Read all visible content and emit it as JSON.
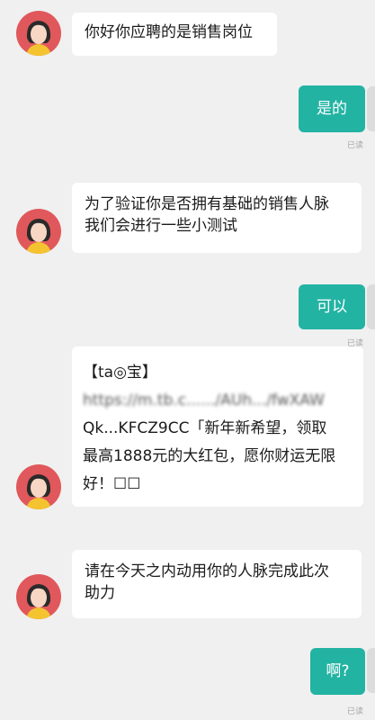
{
  "chat": {
    "messages": [
      {
        "side": "left",
        "text": "你好你应聘的是销售岗位"
      },
      {
        "side": "right",
        "text": "是的",
        "status": "已读"
      },
      {
        "side": "left",
        "lines": [
          "为了验证你是否拥有基础的销售人脉",
          "我们会进行一些小测试"
        ]
      },
      {
        "side": "right",
        "text": "可以",
        "status": "已读"
      },
      {
        "side": "left",
        "link_lines": [
          "【ta◎宝】",
          "https://m.tb.c....../AUh.../fwXAW",
          "Qk...KFCZ9CC「新年新希望，领取",
          "最高1888元的大红包，愿你财运无限",
          "好！☐☐"
        ]
      },
      {
        "side": "left",
        "lines": [
          "请在今天之内动用你的人脉完成此次",
          "助力"
        ]
      },
      {
        "side": "right",
        "text": "啊?",
        "status": "已读"
      }
    ]
  },
  "colors": {
    "background": "#f0f0f0",
    "bubble_left": "#ffffff",
    "bubble_right": "#23b3a3",
    "avatar_bg": "#e0585b"
  }
}
